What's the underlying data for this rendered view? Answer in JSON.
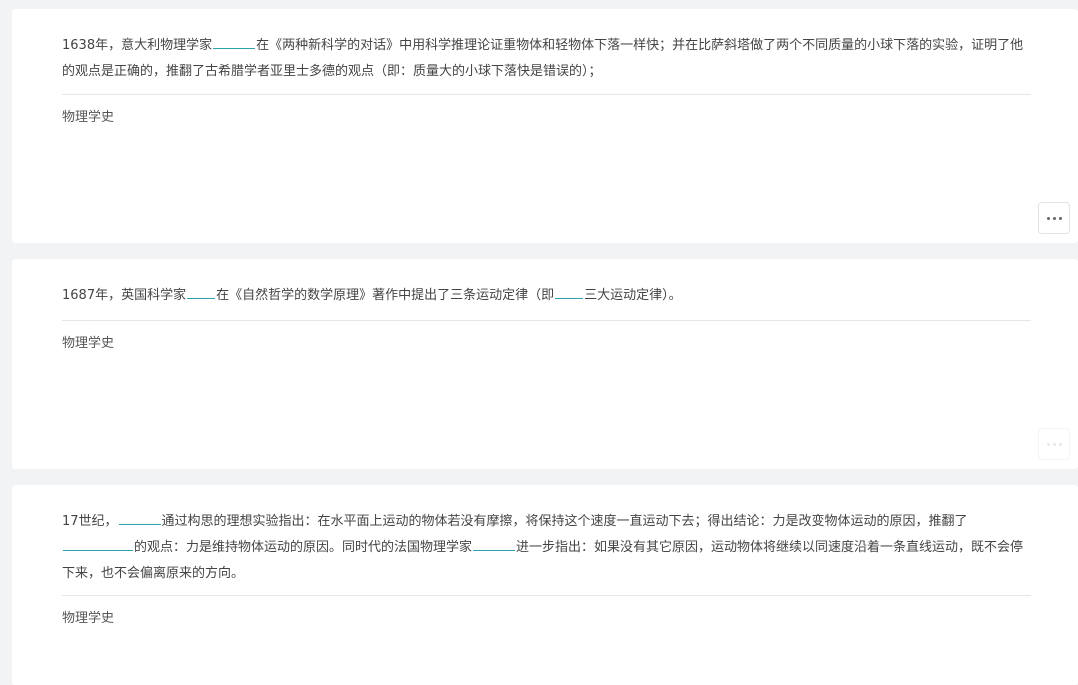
{
  "questions": [
    {
      "segments": [
        {
          "t": "1638年，意大利物理学家"
        },
        {
          "blank": 42
        },
        {
          "t": "在《两种新科学的对话》中用科学推理论证重物体和轻物体下落一样快；并在比萨斜塔做了两个不同质量的小球下落的实验，证明了他的观点是正确的，推翻了古希腊学者亚里士多德的观点（即：质量大的小球下落快是错误的）；"
        }
      ],
      "tag": "物理学史",
      "more_icon": "more-horizontal-icon"
    },
    {
      "segments": [
        {
          "t": "1687年，英国科学家"
        },
        {
          "blank": 28
        },
        {
          "t": "在《自然哲学的数学原理》著作中提出了三条运动定律（即"
        },
        {
          "blank": 28
        },
        {
          "t": "三大运动定律）。"
        }
      ],
      "tag": "物理学史",
      "more_icon": "more-horizontal-icon"
    },
    {
      "segments": [
        {
          "t": "17世纪，"
        },
        {
          "blank": 42
        },
        {
          "t": "通过构思的理想实验指出：在水平面上运动的物体若没有摩擦，将保持这个速度一直运动下去；得出结论：力是改变物体运动的原因，推翻了"
        },
        {
          "blank": 70
        },
        {
          "t": "的观点：力是维持物体运动的原因。同时代的法国物理学家"
        },
        {
          "blank": 42
        },
        {
          "t": "进一步指出：如果没有其它原因，运动物体将继续以同速度沿着一条直线运动，既不会停下来，也不会偏离原来的方向。"
        }
      ],
      "tag": "物理学史"
    }
  ]
}
